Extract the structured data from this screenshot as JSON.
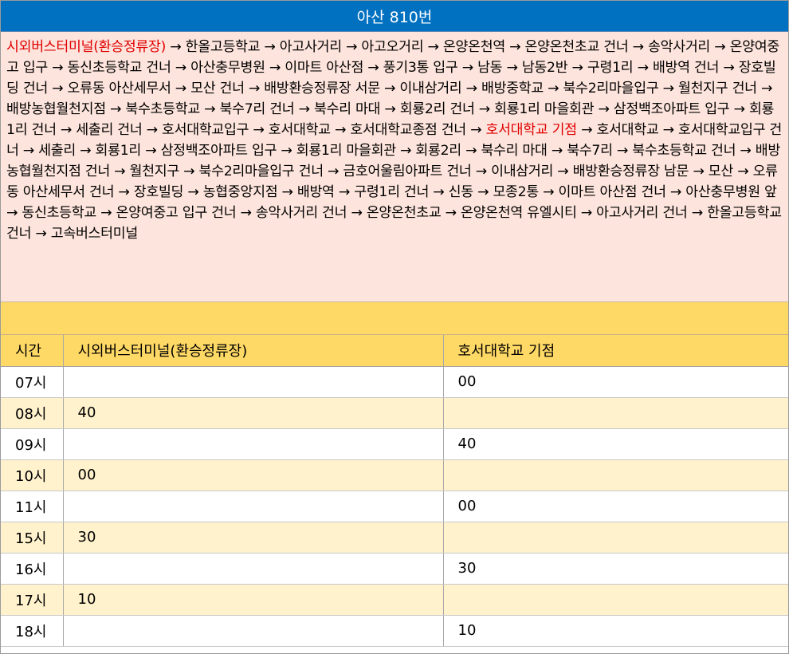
{
  "title": "아산 810번",
  "route": {
    "start": "시외버스터미널(환승정류장)",
    "part1": " → 한올고등학교 → 아고사거리 → 아고오거리 → 온양온천역 → 온양온천초교 건너 → 송악사거리 → 온양여중고 입구 → 동신초등학교 건너 → 아산충무병원 → 이마트 아산점 → 풍기3통 입구 → 남동 → 남동2반 → 구령1리 → 배방역 건너 → 장호빌딩 건너 → 오류동 아산세무서 → 모산 건너 → 배방환승정류장 서문 → 이내삼거리 → 배방중학교 → 북수2리마을입구 → 월천지구 건너 → 배방농협월천지점 → 북수초등학교 → 북수7리 건너 → 북수리 마대 → 회룡2리 건너 → 회룡1리 마을회관 → 삼정백조아파트 입구 → 회룡1리 건너 → 세출리 건너 → 호서대학교입구 → 호서대학교 → 호서대학교종점 건너 → ",
    "turn": "호서대학교 기점",
    "part2": " → 호서대학교 → 호서대학교입구 건너 → 세출리 → 회룡1리 → 삼정백조아파트 입구 → 회룡1리 마을회관 → 회룡2리 → 북수리 마대 → 북수7리 → 북수초등학교 건너 → 배방농협월천지점 건너 → 월천지구 → 북수2리마을입구 건너 → 금호어울림아파트 건너 → 이내삼거리 → 배방환승정류장 남문 → 모산 → 오류동 아산세무서 건너 → 장호빌딩 → 농협중앙지점 → 배방역 → 구령1리 건너 → 신동 → 모종2통 → 이마트 아산점 건너 → 아산충무병원 앞 → 동신초등학교 → 온양여중고 입구 건너 → 송악사거리 건너 → 온양온천초교 → 온양온천역 유엘시티 → 아고사거리 건너 → 한올고등학교 건너 → 고속버스터미널"
  },
  "table": {
    "headers": [
      "시간",
      "시외버스터미널(환승정류장)",
      "호서대학교 기점"
    ],
    "rows": [
      [
        "07시",
        "",
        "00"
      ],
      [
        "08시",
        "40",
        ""
      ],
      [
        "09시",
        "",
        "40"
      ],
      [
        "10시",
        "00",
        ""
      ],
      [
        "11시",
        "",
        "00"
      ],
      [
        "15시",
        "30",
        ""
      ],
      [
        "16시",
        "",
        "30"
      ],
      [
        "17시",
        "10",
        ""
      ],
      [
        "18시",
        "",
        "10"
      ]
    ]
  },
  "colors": {
    "title_bg": "#0070c0",
    "route_bg": "#fde4dc",
    "highlight": "#e00000",
    "header_bg": "#ffd966",
    "row_alt_bg": "#fff2cc"
  }
}
